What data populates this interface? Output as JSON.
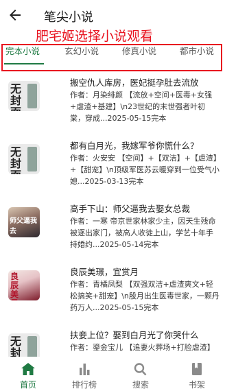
{
  "header": {
    "title": "笔尖小说",
    "overlay_text": "肥宅姬选择小说观看"
  },
  "tabs": [
    {
      "label": "完本小说",
      "active": true
    },
    {
      "label": "玄幻小说",
      "active": false
    },
    {
      "label": "修真小说",
      "active": false
    },
    {
      "label": "都市小说",
      "active": false
    }
  ],
  "books": [
    {
      "cover_text": "无封面",
      "title": "搬空仇人库房，医妃挺孕肚去流放",
      "desc": "作者：月染绯颜  【流放+空间+医毒+女强+虐渣+基建】\\n23世纪的末世强者叶初棠，穿成...2025-05-15完本"
    },
    {
      "cover_text": "无封面",
      "title": "都有白月光，我嫁军爷你慌什么？",
      "desc": "作者：火安安  【空间】+【双洁】+【虐渣】+【甜宠】\\n顶级军医苏云暖穿到一位受气小媳...2025-03-13完本"
    },
    {
      "cover_text": "师父逼我去",
      "title": "高手下山：师父逼我去娶女总裁",
      "desc": "作者：一寒  帝京世家林家少主，因天生残命被逐出家门，被高人收徒上山，学艺十年手持婚约...2025-05-14完本"
    },
    {
      "cover_text": "良辰美景",
      "title": "良辰美璟，宜赏月",
      "desc": "作者：青橘凤梨  【双强双洁+虐渣爽文+轻松搞笑+甜宠】\\n殷月出生医毒世家，一颗丹药万人...2025-05-15完本"
    },
    {
      "cover_text": "无封面",
      "title": "扶妾上位？娶到白月光了你哭什么",
      "desc": "作者：鎏金宝儿  【追妻火葬场+打脸虐渣】"
    }
  ],
  "nav": [
    {
      "label": "首页",
      "icon": "home-icon",
      "active": true
    },
    {
      "label": "排行榜",
      "icon": "bar-chart-icon",
      "active": false
    },
    {
      "label": "搜索",
      "icon": "search-icon",
      "active": false
    },
    {
      "label": "书架",
      "icon": "bookshelf-icon",
      "active": false
    }
  ],
  "colors": {
    "accent": "#1f7a43",
    "annotation": "#e8131f",
    "icon_inactive": "#8a8a8a"
  }
}
